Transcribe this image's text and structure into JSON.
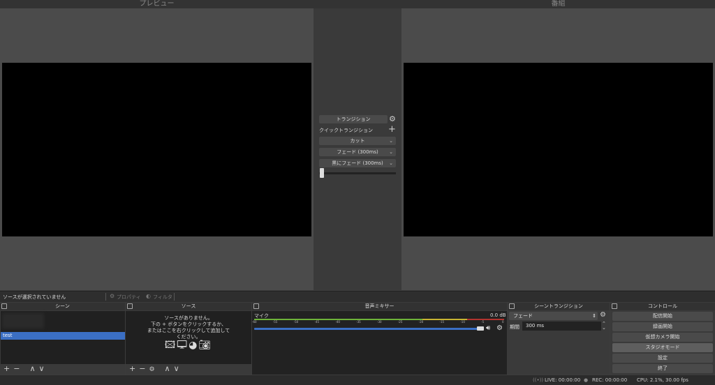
{
  "preview": {
    "title": "プレビュー"
  },
  "program": {
    "title": "番組"
  },
  "transitions": {
    "transition_button": "トランジション",
    "quick_label": "クイックトランジション",
    "items": [
      "カット",
      "フェード (300ms)",
      "黒にフェード (300ms)"
    ],
    "tbar_value": 0
  },
  "sourcebar": {
    "status": "ソースが選択されていません",
    "properties": "プロパティ",
    "filters": "フィルタ"
  },
  "scenes": {
    "title": "シーン",
    "items": [
      "test"
    ]
  },
  "sources": {
    "title": "ソース",
    "empty_text_1": "ソースがありません。",
    "empty_text_2": "下の + ボタンをクリックするか、",
    "empty_text_3": "またはここを右クリックして追加して",
    "empty_text_4": "ください。"
  },
  "mixer": {
    "title": "音声ミキサー",
    "channel": "マイク",
    "db": "0.0 dB",
    "ticks": [
      "-60",
      "-55",
      "-50",
      "-45",
      "-40",
      "-35",
      "-30",
      "-25",
      "-20",
      "-15",
      "-10",
      "-5",
      "0"
    ],
    "volume": 1.0
  },
  "scene_transition": {
    "title": "シーントランジション",
    "type": "フェード",
    "duration_label": "期間",
    "duration_value": "300 ms"
  },
  "controls": {
    "title": "コントロール",
    "buttons": [
      "配信開始",
      "録画開始",
      "仮想カメラ開始",
      "スタジオモード",
      "設定",
      "終了"
    ]
  },
  "status": {
    "live": "LIVE: 00:00:00",
    "rec": "REC: 00:00:00",
    "cpu": "CPU: 2.1%, 30.00 fps"
  },
  "colors": {
    "selected": "#3b6fc4",
    "meter_green": "#6eb33a",
    "meter_yellow": "#c8b432",
    "meter_red": "#b2342f"
  }
}
